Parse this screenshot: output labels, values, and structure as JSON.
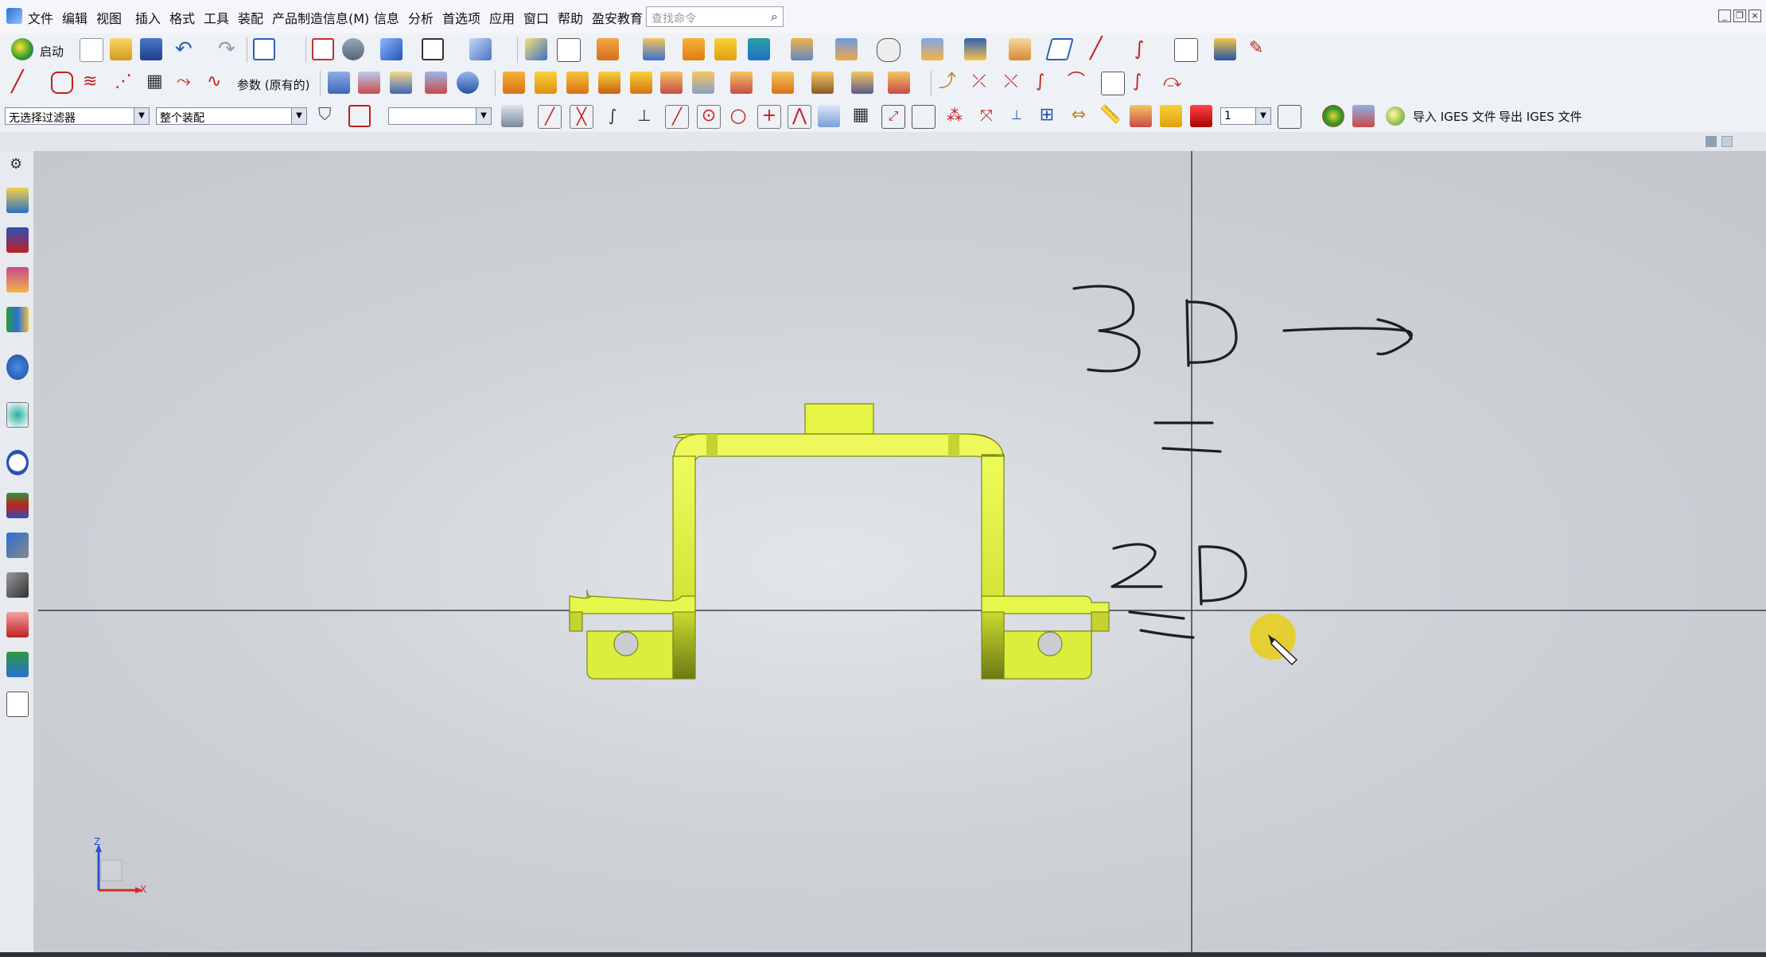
{
  "menubar": {
    "items": [
      "文件",
      "编辑",
      "视图",
      "插入",
      "格式",
      "工具",
      "装配",
      "产品制造信息(M)",
      "信息",
      "分析",
      "首选项",
      "应用",
      "窗口",
      "帮助",
      "盈安教育"
    ],
    "search_placeholder": "查找命令"
  },
  "toolbar1": {
    "start_label": "启动"
  },
  "toolbar2": {
    "param_label": "参数 (原有的)"
  },
  "toolbar3": {
    "filter_value": "无选择过滤器",
    "scope_value": "整个装配",
    "layer_value": "",
    "number_value": "1",
    "import_iges": "导入 IGES 文件",
    "export_iges": "导出 IGES 文件"
  },
  "annotations": {
    "line1": "3D →",
    "line2": "=",
    "line3": "2D",
    "line4": "="
  },
  "triad": {
    "z_label": "Z",
    "x_label": "X"
  },
  "colors": {
    "part": "#e4f542",
    "part_dark": "#9fb01f",
    "background": "#d3d7dc",
    "cursor_highlight": "#e5cf2a"
  }
}
